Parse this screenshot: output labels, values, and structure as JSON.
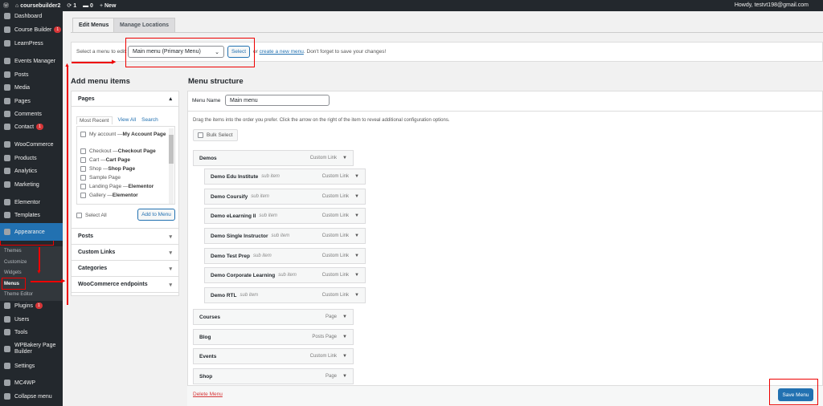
{
  "adminbar": {
    "site": "coursebuilder2",
    "updates": "1",
    "comments": "0",
    "new": "New",
    "howdy": "Howdy, testvt198@gmail.com"
  },
  "sidebar": {
    "items": [
      {
        "label": "Dashboard",
        "icon": "dashboard-icon"
      },
      {
        "label": "Course Builder",
        "icon": "course-builder-icon",
        "badge": "1"
      },
      {
        "label": "LearnPress",
        "icon": "learnpress-icon"
      },
      {
        "label": "Events Manager",
        "icon": "calendar-icon"
      },
      {
        "label": "Posts",
        "icon": "pin-icon"
      },
      {
        "label": "Media",
        "icon": "media-icon"
      },
      {
        "label": "Pages",
        "icon": "pages-icon"
      },
      {
        "label": "Comments",
        "icon": "comment-icon"
      },
      {
        "label": "Contact",
        "icon": "mail-icon",
        "badge": "1"
      },
      {
        "label": "WooCommerce",
        "icon": "woocommerce-icon"
      },
      {
        "label": "Products",
        "icon": "products-icon"
      },
      {
        "label": "Analytics",
        "icon": "analytics-icon"
      },
      {
        "label": "Marketing",
        "icon": "megaphone-icon"
      },
      {
        "label": "Elementor",
        "icon": "elementor-icon"
      },
      {
        "label": "Templates",
        "icon": "folder-icon"
      },
      {
        "label": "Appearance",
        "icon": "brush-icon"
      },
      {
        "label": "Plugins",
        "icon": "plugin-icon",
        "badge": "1"
      },
      {
        "label": "Users",
        "icon": "users-icon"
      },
      {
        "label": "Tools",
        "icon": "wrench-icon"
      },
      {
        "label": "WPBakery Page Builder",
        "icon": "wpbakery-icon"
      },
      {
        "label": "Settings",
        "icon": "settings-icon"
      },
      {
        "label": "MC4WP",
        "icon": "mc4wp-icon"
      },
      {
        "label": "Collapse menu",
        "icon": "collapse-icon"
      }
    ],
    "submenu": [
      "Themes",
      "Customize",
      "Widgets",
      "Menus",
      "Theme Editor"
    ]
  },
  "tabs": [
    "Edit Menus",
    "Manage Locations"
  ],
  "selectbar": {
    "label": "Select a menu to edit:",
    "value": "Main menu (Primary Menu)",
    "button": "Select",
    "or": "or",
    "link": "create a new menu",
    "tail": ". Don't forget to save your changes!"
  },
  "add": {
    "title": "Add menu items",
    "pages": "Pages",
    "subtabs": [
      "Most Recent",
      "View All",
      "Search"
    ],
    "list": [
      [
        "My account — ",
        "My Account Page"
      ],
      [
        "Checkout — ",
        "Checkout Page"
      ],
      [
        "Cart — ",
        "Cart Page"
      ],
      [
        "Shop — ",
        "Shop Page"
      ],
      [
        "Sample Page",
        ""
      ],
      [
        "Landing Page — ",
        "Elementor"
      ],
      [
        "Gallery — ",
        "Elementor"
      ]
    ],
    "select_all": "Select All",
    "add_button": "Add to Menu",
    "sections": [
      "Posts",
      "Custom Links",
      "Categories",
      "WooCommerce endpoints"
    ]
  },
  "structure": {
    "title": "Menu structure",
    "name_label": "Menu Name",
    "name_value": "Main menu",
    "hint": "Drag the items into the order you prefer. Click the arrow on the right of the item to reveal additional configuration options.",
    "bulk": "Bulk Select",
    "items": [
      {
        "label": "Demos",
        "type": "Custom Link",
        "sub": false
      },
      {
        "label": "Demo Edu Institute",
        "type": "Custom Link",
        "sub": true
      },
      {
        "label": "Demo Coursify",
        "type": "Custom Link",
        "sub": true
      },
      {
        "label": "Demo eLearning II",
        "type": "Custom Link",
        "sub": true
      },
      {
        "label": "Demo Single Instructor",
        "type": "Custom Link",
        "sub": true
      },
      {
        "label": "Demo Test Prep",
        "type": "Custom Link",
        "sub": true
      },
      {
        "label": "Demo Corporate Learning",
        "type": "Custom Link",
        "sub": true
      },
      {
        "label": "Demo RTL",
        "type": "Custom Link",
        "sub": true
      },
      {
        "label": "Courses",
        "type": "Page",
        "sub": false
      },
      {
        "label": "Blog",
        "type": "Posts Page",
        "sub": false
      },
      {
        "label": "Events",
        "type": "Custom Link",
        "sub": false
      },
      {
        "label": "Shop",
        "type": "Page",
        "sub": false
      }
    ],
    "sub_item": "sub item",
    "delete": "Delete Menu",
    "save": "Save Menu"
  }
}
